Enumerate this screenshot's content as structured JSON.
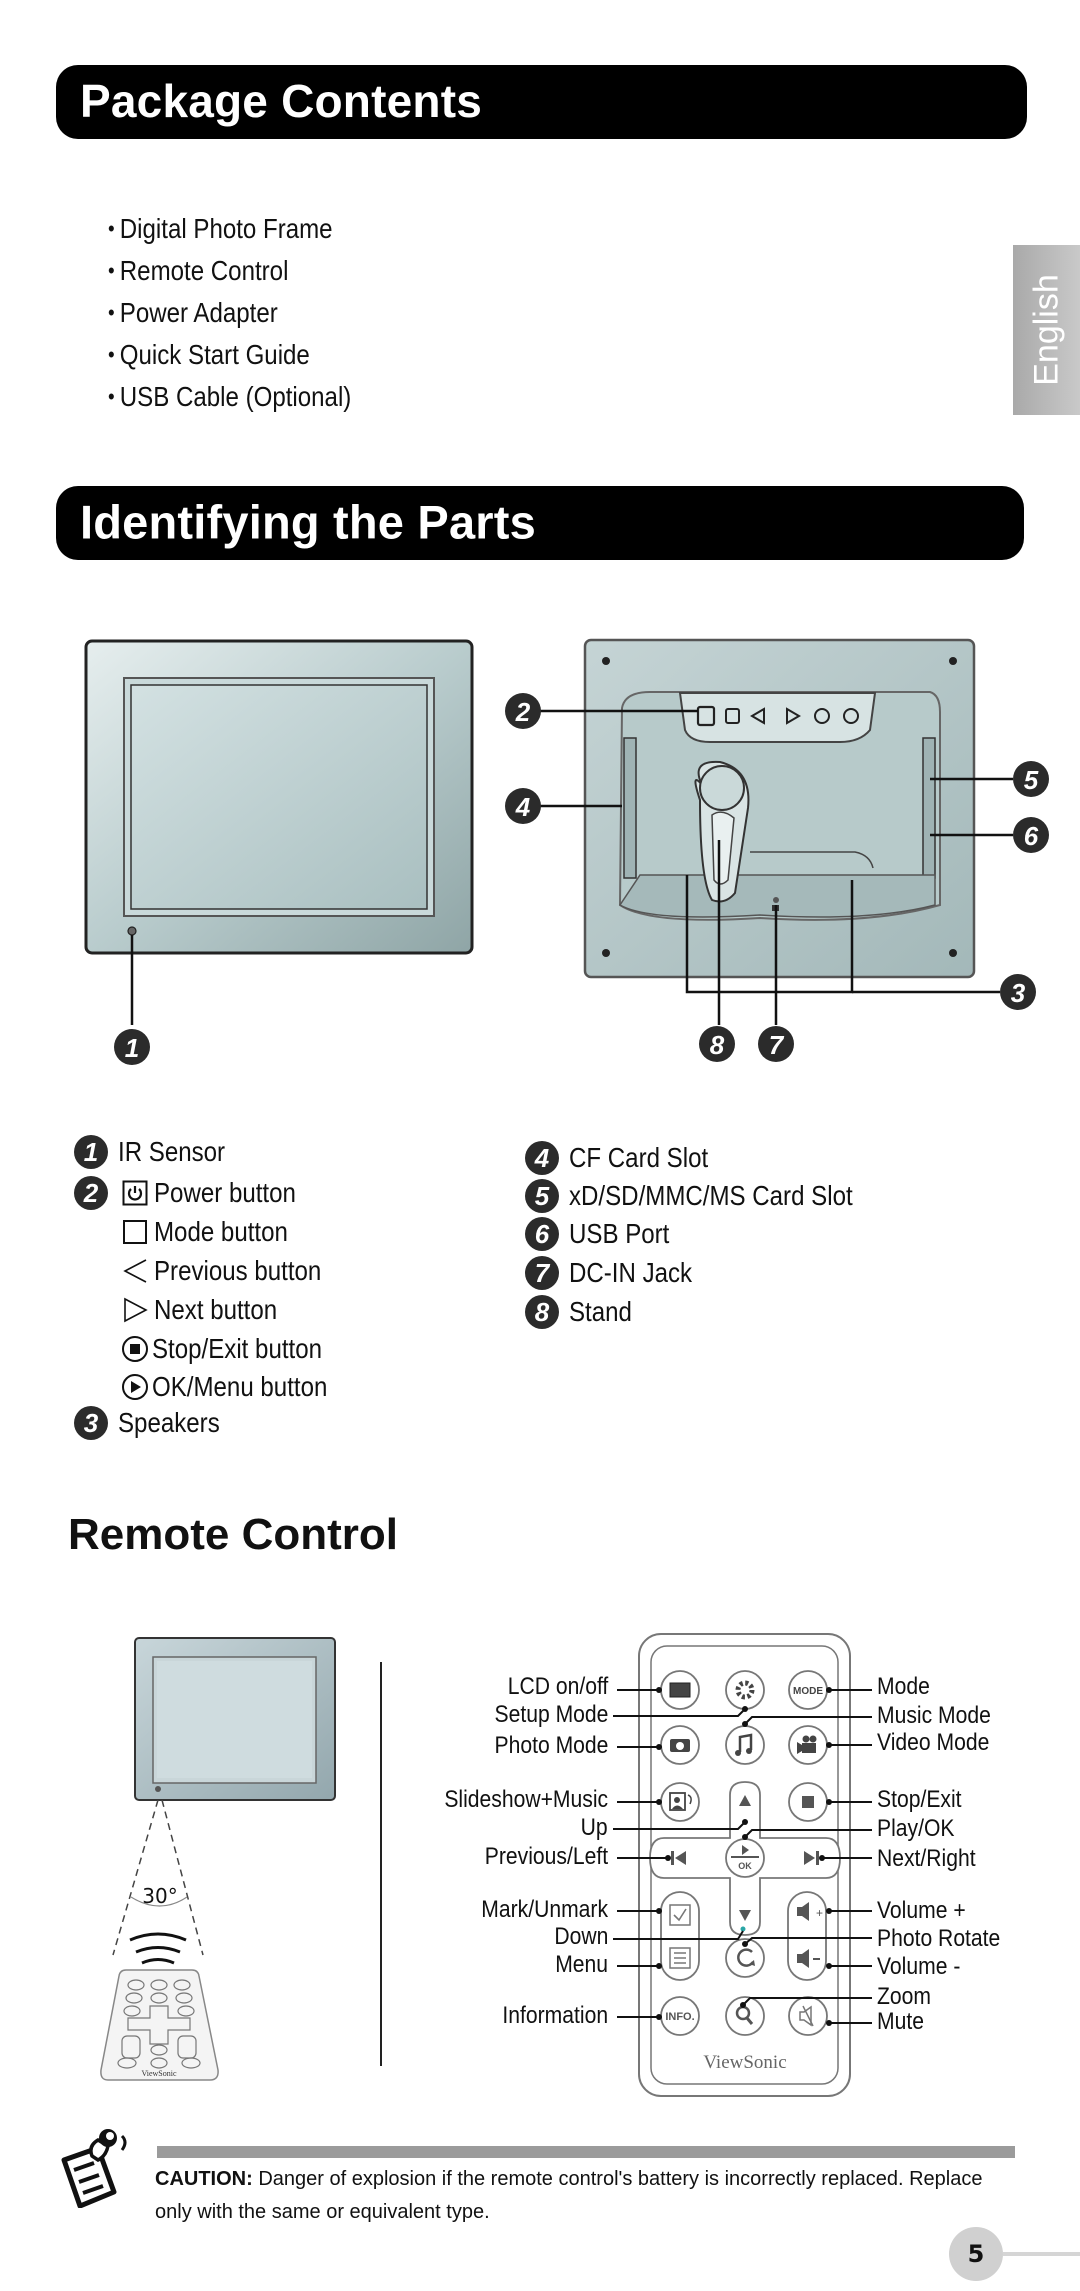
{
  "language_tab": "English",
  "package_contents": {
    "title": "Package Contents",
    "items": [
      "Digital Photo Frame",
      "Remote Control",
      "Power Adapter",
      "Quick Start Guide",
      "USB Cable (Optional)"
    ]
  },
  "identifying_parts": {
    "title": "Identifying the Parts",
    "callouts": [
      "1",
      "2",
      "3",
      "4",
      "5",
      "6",
      "7",
      "8"
    ],
    "left_list": [
      {
        "badge": "1",
        "label": "IR Sensor"
      },
      {
        "badge": "2",
        "icon": "power-icon",
        "label": "Power button"
      },
      {
        "icon": "square-icon",
        "label": "Mode button"
      },
      {
        "icon": "triangle-left-icon",
        "label": "Previous button"
      },
      {
        "icon": "triangle-right-icon",
        "label": "Next button"
      },
      {
        "icon": "stop-circle-icon",
        "label": "Stop/Exit button"
      },
      {
        "icon": "play-circle-icon",
        "label": "OK/Menu button"
      },
      {
        "badge": "3",
        "label": "Speakers"
      }
    ],
    "right_list": [
      {
        "badge": "4",
        "label": "CF Card Slot"
      },
      {
        "badge": "5",
        "label": "xD/SD/MMC/MS Card Slot"
      },
      {
        "badge": "6",
        "label": "USB Port"
      },
      {
        "badge": "7",
        "label": "DC-IN Jack"
      },
      {
        "badge": "8",
        "label": "Stand"
      }
    ]
  },
  "remote_control": {
    "title": "Remote Control",
    "angle_label": "30°",
    "brand": "ViewSonic",
    "button_texts": {
      "mode": "MODE",
      "ok": "OK",
      "info": "INFO."
    },
    "left_labels": [
      "LCD on/off",
      "Setup Mode",
      "Photo Mode",
      "Slideshow+Music",
      "Up",
      "Previous/Left",
      "Mark/Unmark",
      "Down",
      "Menu",
      "Information"
    ],
    "right_labels": [
      "Mode",
      "Music Mode",
      "Video Mode",
      "Stop/Exit",
      "Play/OK",
      "Next/Right",
      "Volume +",
      "Photo Rotate",
      "Volume -",
      "Zoom",
      "Mute"
    ]
  },
  "caution": {
    "label": "CAUTION:",
    "text": " Danger of explosion if the remote control's battery is incorrectly replaced. Replace only with the same or equivalent type."
  },
  "page_number": "5"
}
